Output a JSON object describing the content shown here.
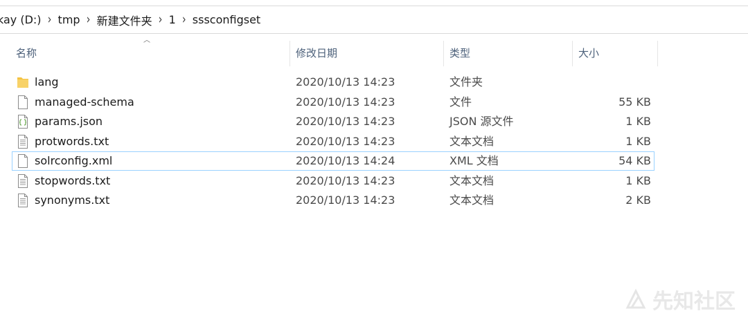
{
  "breadcrumb": [
    "kay (D:)",
    "tmp",
    "新建文件夹",
    "1",
    "sssconfigset"
  ],
  "columns": {
    "name": "名称",
    "date": "修改日期",
    "type": "类型",
    "size": "大小"
  },
  "files": [
    {
      "name": "lang",
      "date": "2020/10/13 14:23",
      "type": "文件夹",
      "size": "",
      "icon": "folder-icon"
    },
    {
      "name": "managed-schema",
      "date": "2020/10/13 14:23",
      "type": "文件",
      "size": "55 KB",
      "icon": "file-icon"
    },
    {
      "name": "params.json",
      "date": "2020/10/13 14:23",
      "type": "JSON 源文件",
      "size": "1 KB",
      "icon": "json-file-icon"
    },
    {
      "name": "protwords.txt",
      "date": "2020/10/13 14:23",
      "type": "文本文档",
      "size": "1 KB",
      "icon": "text-file-icon"
    },
    {
      "name": "solrconfig.xml",
      "date": "2020/10/13 14:24",
      "type": "XML 文档",
      "size": "54 KB",
      "icon": "file-icon"
    },
    {
      "name": "stopwords.txt",
      "date": "2020/10/13 14:23",
      "type": "文本文档",
      "size": "1 KB",
      "icon": "text-file-icon"
    },
    {
      "name": "synonyms.txt",
      "date": "2020/10/13 14:23",
      "type": "文本文档",
      "size": "2 KB",
      "icon": "text-file-icon"
    }
  ],
  "selected_file": "solrconfig.xml",
  "watermark": "先知社区",
  "colors": {
    "selection_border": "#99d1ff",
    "header_text": "#4c607a",
    "folder": "#f5c342"
  }
}
